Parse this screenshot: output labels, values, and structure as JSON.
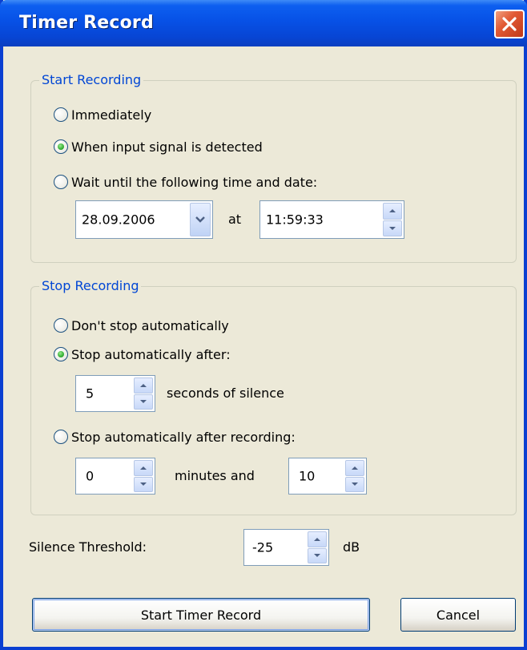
{
  "window": {
    "title": "Timer Record"
  },
  "start_group": {
    "legend": "Start Recording",
    "options": [
      {
        "label": "Immediately",
        "selected": false
      },
      {
        "label": "When input signal is detected",
        "selected": true
      },
      {
        "label": "Wait until the following time and date:",
        "selected": false
      }
    ],
    "date": "28.09.2006",
    "at_label": "at",
    "time": "11:59:33"
  },
  "stop_group": {
    "legend": "Stop Recording",
    "options": [
      {
        "label": "Don't stop automatically",
        "selected": false
      },
      {
        "label": "Stop automatically after:",
        "selected": true
      },
      {
        "label": "Stop automatically after recording:",
        "selected": false
      }
    ],
    "silence_seconds": "5",
    "silence_label": "seconds of silence",
    "minutes": "0",
    "minutes_label": "minutes and",
    "seconds": "10"
  },
  "threshold": {
    "label": "Silence Threshold:",
    "value": "-25",
    "unit": "dB"
  },
  "buttons": {
    "start": "Start Timer Record",
    "cancel": "Cancel"
  },
  "colors": {
    "accent": "#0046d5",
    "titlebar": "#0751e6",
    "radio_dot": "#3cb53a",
    "close": "#e25a35"
  }
}
